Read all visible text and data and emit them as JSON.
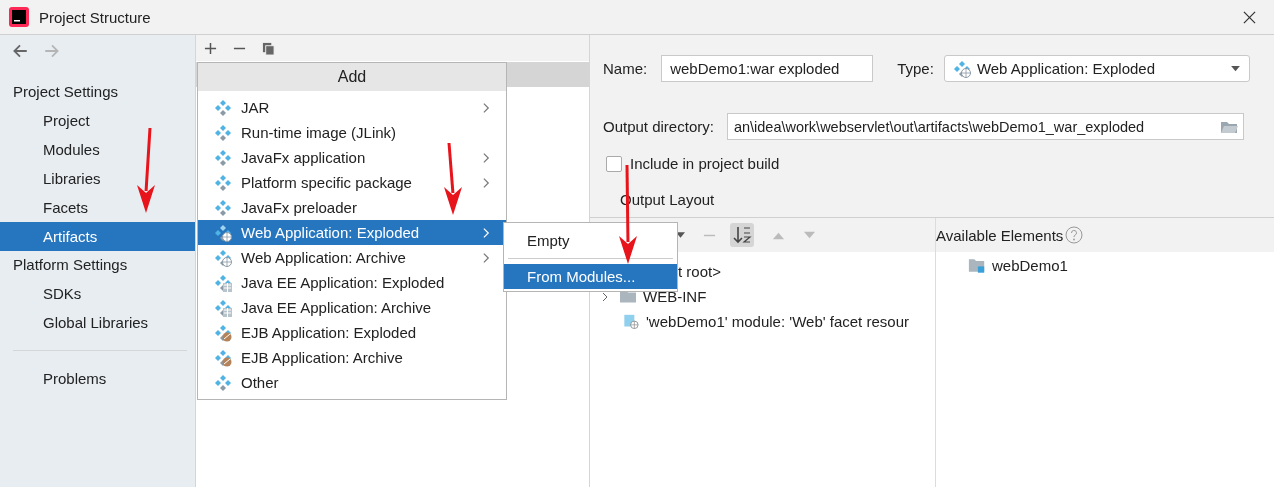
{
  "window": {
    "title": "Project Structure"
  },
  "sidebar": {
    "sections": [
      {
        "title": "Project Settings",
        "items": [
          {
            "label": "Project",
            "selected": false
          },
          {
            "label": "Modules",
            "selected": false
          },
          {
            "label": "Libraries",
            "selected": false
          },
          {
            "label": "Facets",
            "selected": false
          },
          {
            "label": "Artifacts",
            "selected": true
          }
        ]
      },
      {
        "title": "Platform Settings",
        "items": [
          {
            "label": "SDKs",
            "selected": false
          },
          {
            "label": "Global Libraries",
            "selected": false
          }
        ]
      },
      {
        "items": [
          {
            "label": "Problems",
            "selected": false
          }
        ]
      }
    ]
  },
  "add_menu": {
    "title": "Add",
    "items": [
      {
        "label": "JAR",
        "kind": "plain",
        "submenu": true,
        "selected": false
      },
      {
        "label": "Run-time image (JLink)",
        "kind": "plain",
        "submenu": false,
        "selected": false
      },
      {
        "label": "JavaFx application",
        "kind": "plain",
        "submenu": true,
        "selected": false
      },
      {
        "label": "Platform specific package",
        "kind": "plain",
        "submenu": true,
        "selected": false
      },
      {
        "label": "JavaFx preloader",
        "kind": "plain",
        "submenu": false,
        "selected": false
      },
      {
        "label": "Web Application: Exploded",
        "kind": "web",
        "submenu": true,
        "selected": true
      },
      {
        "label": "Web Application: Archive",
        "kind": "web",
        "submenu": true,
        "selected": false
      },
      {
        "label": "Java EE Application: Exploded",
        "kind": "javaee",
        "submenu": false,
        "selected": false
      },
      {
        "label": "Java EE Application: Archive",
        "kind": "javaee",
        "submenu": false,
        "selected": false
      },
      {
        "label": "EJB Application: Exploded",
        "kind": "ejb",
        "submenu": false,
        "selected": false
      },
      {
        "label": "EJB Application: Archive",
        "kind": "ejb",
        "submenu": false,
        "selected": false
      },
      {
        "label": "Other",
        "kind": "plain",
        "submenu": false,
        "selected": false
      }
    ]
  },
  "submenu": {
    "items": [
      {
        "label": "Empty",
        "selected": false
      },
      {
        "label": "From Modules...",
        "selected": true
      }
    ]
  },
  "form": {
    "name_label": "Name:",
    "name_value": "webDemo1:war exploded",
    "type_label": "Type:",
    "type_value": "Web Application: Exploded",
    "output_label": "Output directory:",
    "output_value": "an\\idea\\work\\webservlet\\out\\artifacts\\webDemo1_war_exploded",
    "include_label": "Include in project build",
    "include_checked": false,
    "layout_label": "Output Layout"
  },
  "layout": {
    "tree": [
      {
        "label": "t root>",
        "kind": "root"
      },
      {
        "label": "WEB-INF",
        "kind": "folder"
      },
      {
        "label": "'webDemo1' module: 'Web' facet resour",
        "kind": "web"
      }
    ],
    "available_title": "Available Elements",
    "available": [
      {
        "label": "webDemo1"
      }
    ]
  },
  "annotations": [
    {
      "kind": "arrow"
    },
    {
      "kind": "arrow"
    },
    {
      "kind": "arrow"
    }
  ]
}
